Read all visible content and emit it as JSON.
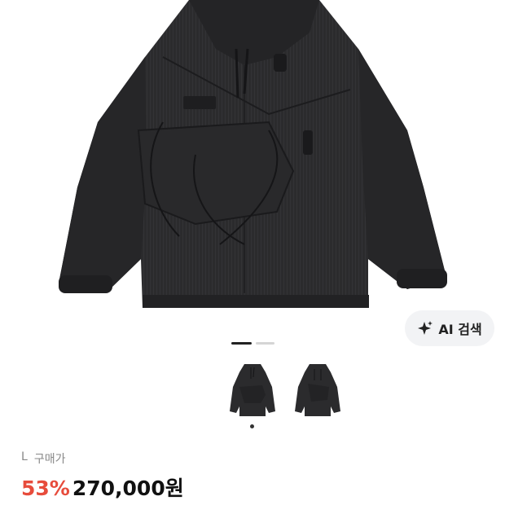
{
  "product": {
    "image_icon": "jacket-image",
    "thumbnails": [
      {
        "icon": "jacket-thumbnail-front"
      },
      {
        "icon": "jacket-thumbnail-alt"
      }
    ],
    "gallery": {
      "active_index": 0,
      "total": 2
    },
    "size": "L",
    "price_label": "구매가",
    "discount": "53%",
    "price": "270,000원"
  },
  "ai_search": {
    "label": "AI 검색",
    "icon": "sparkle-icon"
  },
  "colors": {
    "discount": "#e74c3c",
    "jacket": "#2b2b2d"
  }
}
